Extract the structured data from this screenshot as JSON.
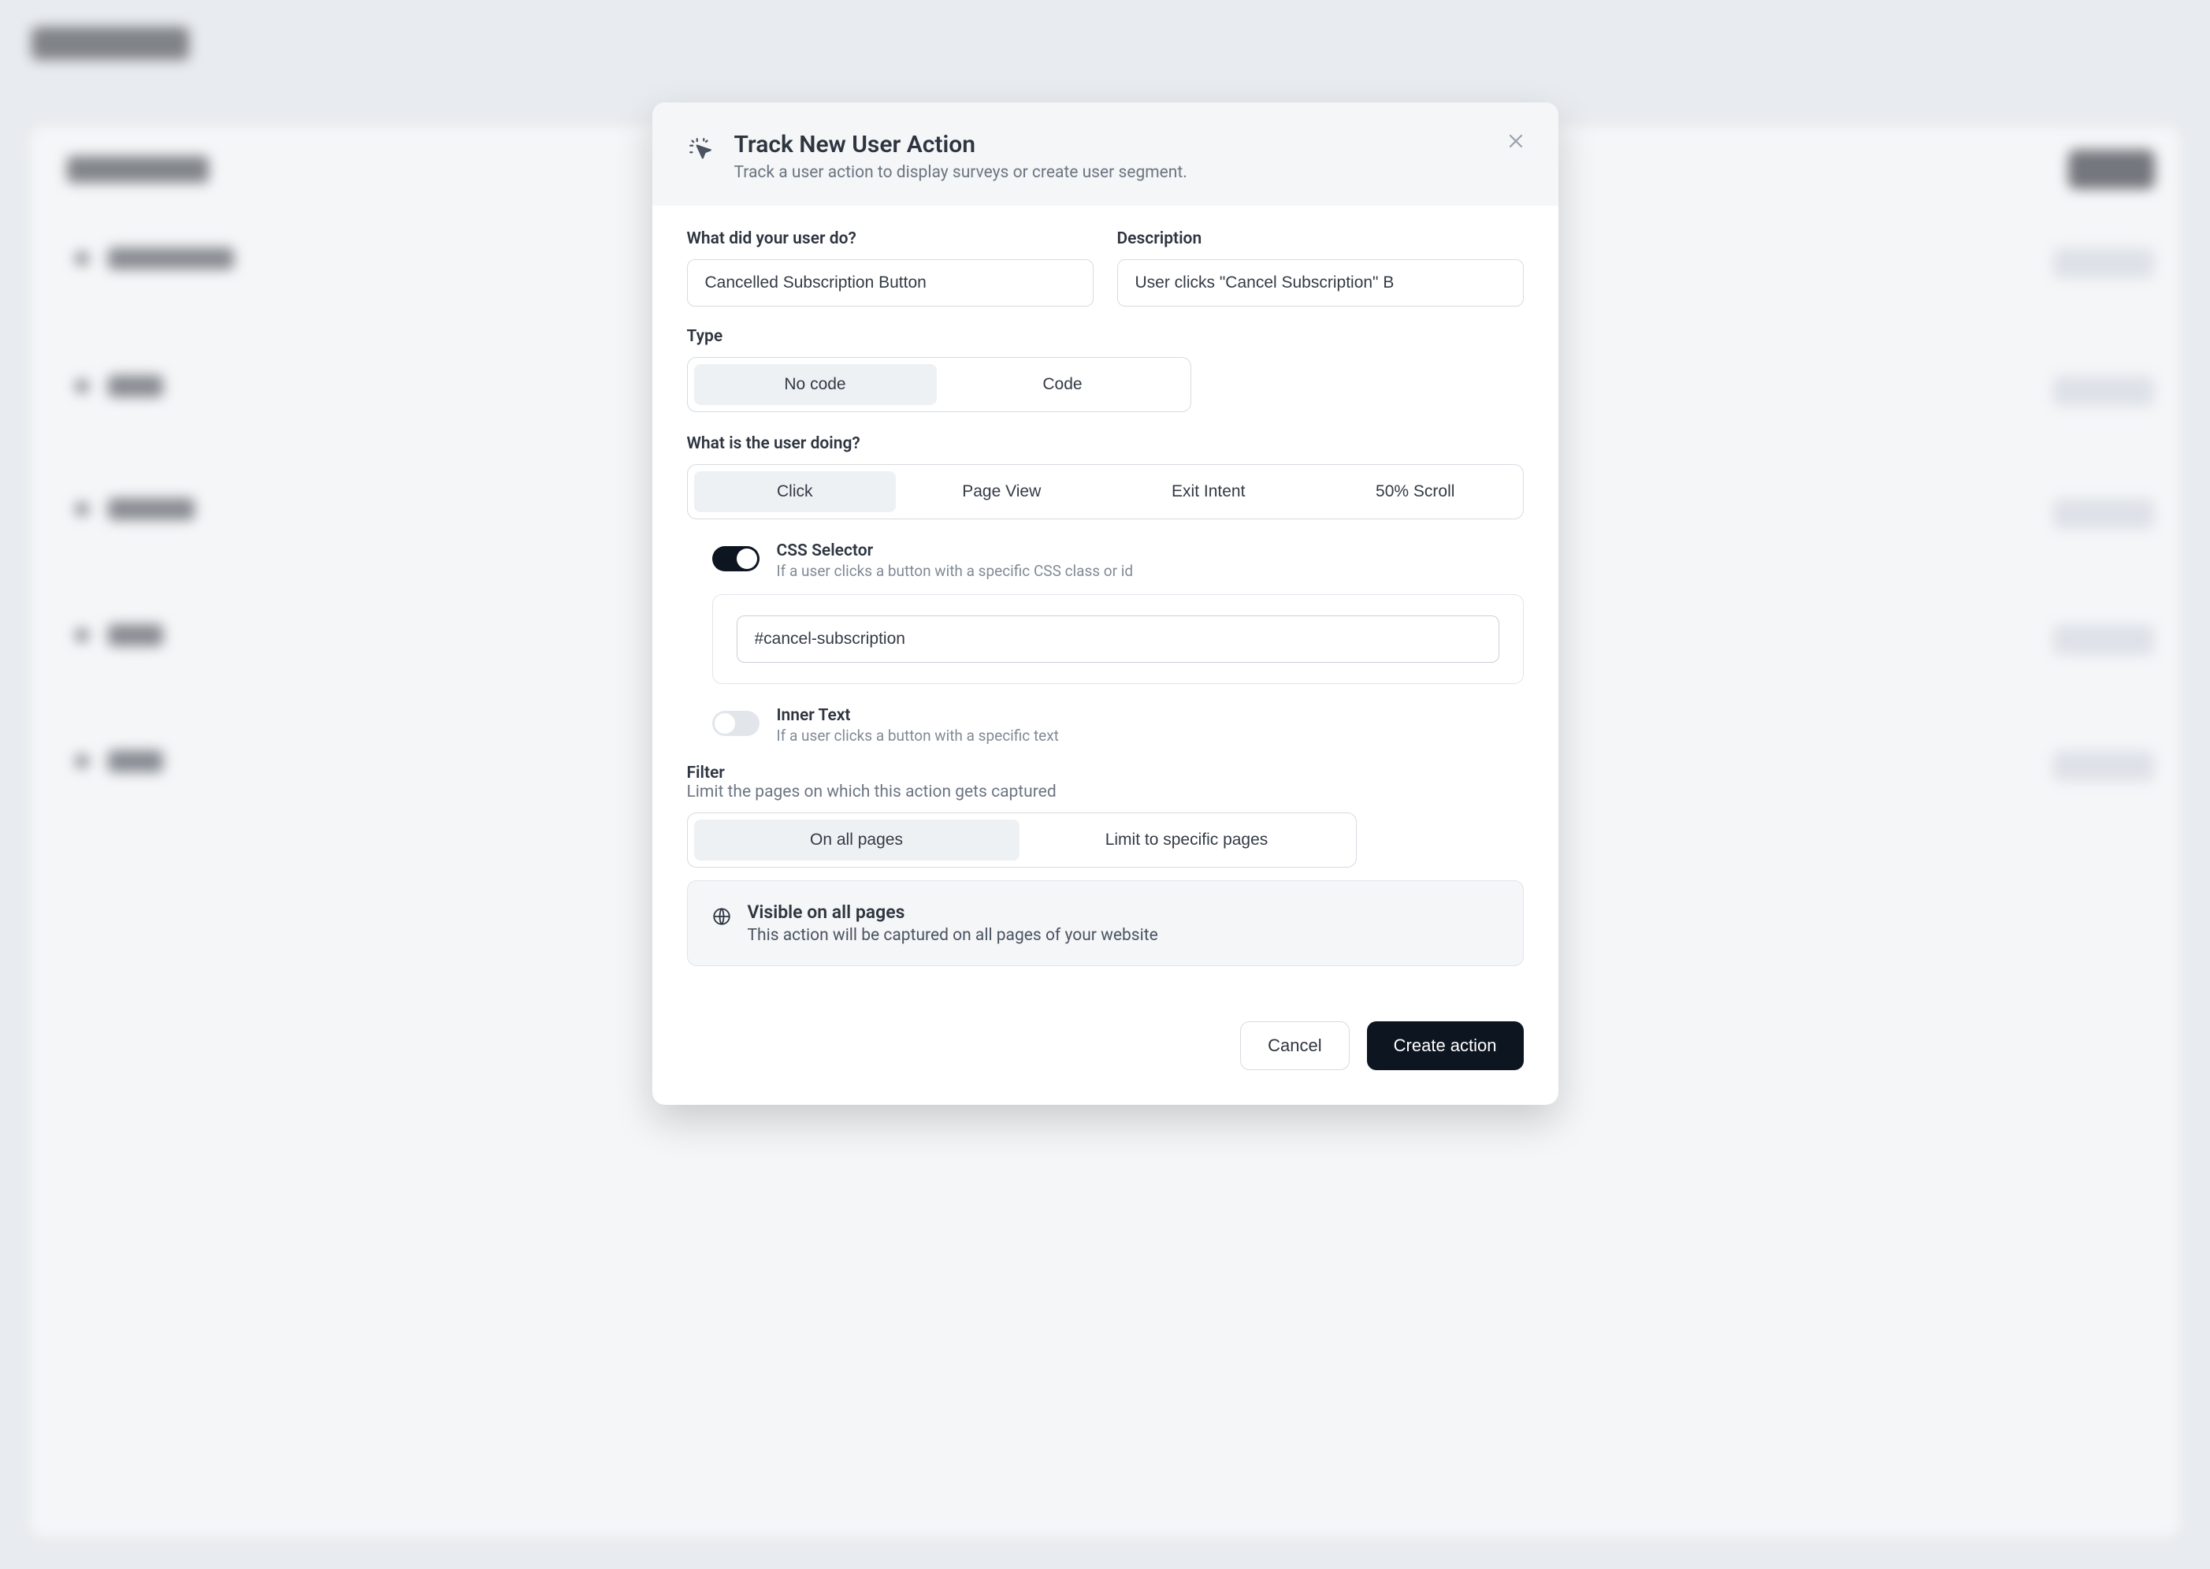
{
  "modal": {
    "title": "Track New User Action",
    "subtitle": "Track a user action to display surveys or create user segment.",
    "fields": {
      "name_label": "What did your user do?",
      "name_value": "Cancelled Subscription Button",
      "desc_label": "Description",
      "desc_value": "User clicks \"Cancel Subscription\" B"
    },
    "type": {
      "label": "Type",
      "options": [
        "No code",
        "Code"
      ],
      "selected": "No code"
    },
    "trigger": {
      "label": "What is the user doing?",
      "options": [
        "Click",
        "Page View",
        "Exit Intent",
        "50% Scroll"
      ],
      "selected": "Click"
    },
    "css_selector": {
      "enabled": true,
      "title": "CSS Selector",
      "desc": "If a user clicks a button with a specific CSS class or id",
      "value": "#cancel-subscription"
    },
    "inner_text": {
      "enabled": false,
      "title": "Inner Text",
      "desc": "If a user clicks a button with a specific text"
    },
    "filter": {
      "label": "Filter",
      "sublabel": "Limit the pages on which this action gets captured",
      "options": [
        "On all pages",
        "Limit to specific pages"
      ],
      "selected": "On all pages",
      "info_title": "Visible on all pages",
      "info_desc": "This action will be captured on all pages of your website"
    },
    "buttons": {
      "cancel": "Cancel",
      "submit": "Create action"
    }
  }
}
